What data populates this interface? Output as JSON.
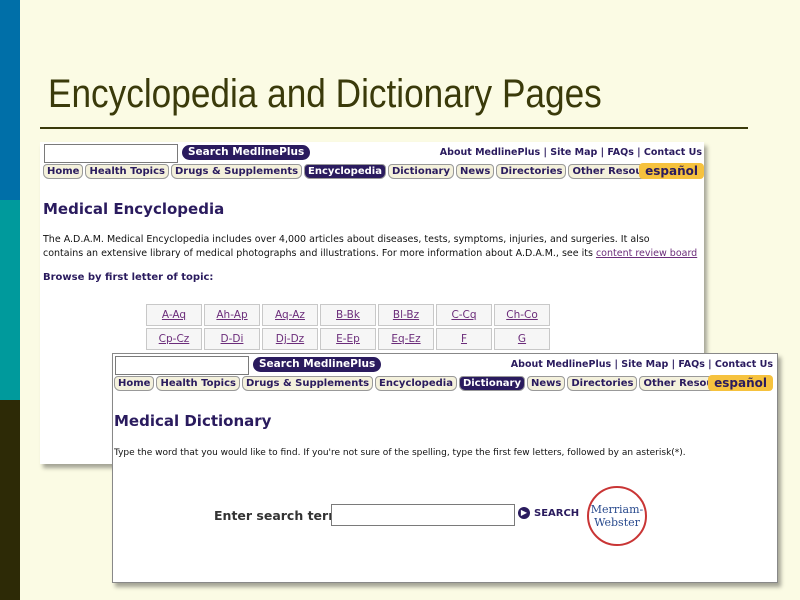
{
  "slide": {
    "title": "Encyclopedia and Dictionary Pages"
  },
  "encyclopedia": {
    "search_button": "Search MedlinePlus",
    "top_links": "About MedlinePlus |  Site Map | FAQs |  Contact Us",
    "tabs": [
      "Home",
      "Health Topics",
      "Drugs & Supplements",
      "Encyclopedia",
      "Dictionary",
      "News",
      "Directories",
      "Other Resources"
    ],
    "active_tab": "Encyclopedia",
    "espanol": "español",
    "heading": "Medical Encyclopedia",
    "intro_line1": "The A.D.A.M. Medical Encyclopedia includes over 4,000 articles about diseases, tests, symptoms, injuries, and surgeries. It also",
    "intro_line2": "contains an extensive library of medical photographs and illustrations. For more information about A.D.A.M., see its ",
    "intro_link": "content review board",
    "browse_label": "Browse by first letter of topic:",
    "letters_row1": [
      "A-Aq",
      "Ah-Ap",
      "Aq-Az",
      "B-Bk",
      "Bl-Bz",
      "C-Cq",
      "Ch-Co"
    ],
    "letters_row2": [
      "Cp-Cz",
      "D-Di",
      "Dj-Dz",
      "E-Ep",
      "Eq-Ez",
      "F",
      "G"
    ]
  },
  "dictionary": {
    "search_button": "Search MedlinePlus",
    "top_links": "About MedlinePlus |  Site Map | FAQs |  Contact Us",
    "tabs": [
      "Home",
      "Health Topics",
      "Drugs & Supplements",
      "Encyclopedia",
      "Dictionary",
      "News",
      "Directories",
      "Other Resources"
    ],
    "active_tab": "Dictionary",
    "espanol": "español",
    "heading": "Medical Dictionary",
    "instructions": "Type the word that you would like to find.  If you're not sure of the spelling, type the first few letters, followed by an asterisk(*).",
    "enter_label": "Enter search term",
    "input_value": "",
    "search_label": "SEARCH",
    "logo_line1": "Merriam-",
    "logo_line2": "Webster"
  },
  "colors": {
    "band_top": "#006fa8",
    "band_mid": "#009a9c",
    "band_bottom": "#2d2a06",
    "site_navy": "#2a1b5e",
    "espanol": "#f6c23e"
  }
}
